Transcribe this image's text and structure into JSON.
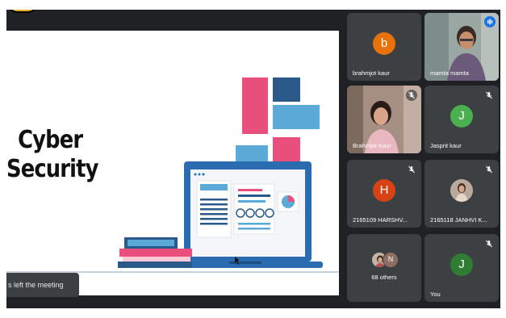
{
  "slide": {
    "title_line1": "Cyber",
    "title_line2": "Security"
  },
  "notification": {
    "text": "s left the meeting"
  },
  "participants": [
    {
      "name": "brahmjot kaur",
      "initial": "b",
      "avatar_color": "#e8710a",
      "muted": false,
      "video": false
    },
    {
      "name": "mamta mamta",
      "muted": false,
      "video": true,
      "speaking": true
    },
    {
      "name": "Brahmjot Kaur",
      "muted": true,
      "video": true
    },
    {
      "name": "Jasprit kaur",
      "initial": "J",
      "avatar_color": "#4caf50",
      "muted": true,
      "video": false
    },
    {
      "name": "2165109 HARSHV...",
      "initial": "H",
      "avatar_color": "#d84315",
      "muted": true,
      "video": false
    },
    {
      "name": "2165118 JANHVI K...",
      "muted": true,
      "video": false,
      "photo_avatar": true
    },
    {
      "name": "68 others",
      "initial": "N",
      "others_avatar_color": "#8d6e63",
      "video": false
    },
    {
      "name": "You",
      "initial": "J",
      "avatar_color": "#2e7d32",
      "muted": true,
      "video": false
    }
  ],
  "colors": {
    "meet_bg": "#202124",
    "tile_bg": "#3c4043",
    "active_outline": "#8ab4f8",
    "slide_pink": "#e94f7c",
    "slide_blue": "#4a90c2",
    "slide_navy": "#2b5a8a"
  }
}
